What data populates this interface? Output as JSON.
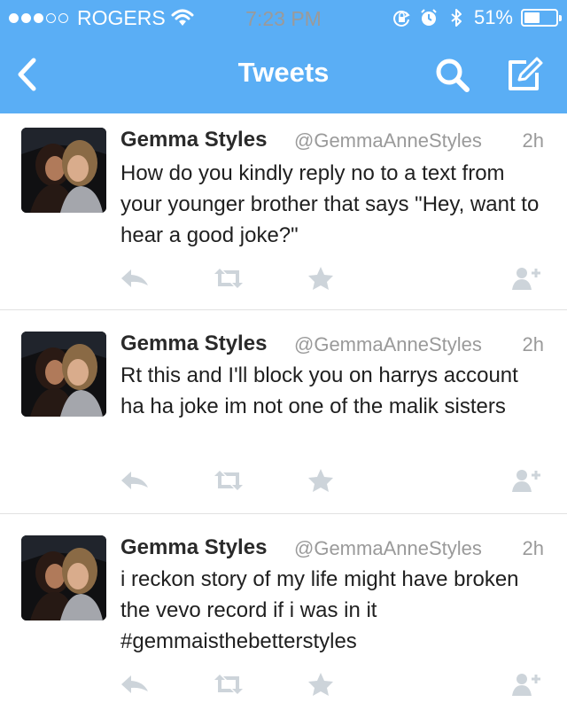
{
  "status_bar": {
    "carrier": "ROGERS",
    "time": "7:23 PM",
    "battery": "51%",
    "battery_level": 0.51
  },
  "nav": {
    "title": "Tweets",
    "back_icon": "chevron-left-icon",
    "search_icon": "search-icon",
    "compose_icon": "compose-icon"
  },
  "tweets": [
    {
      "name": "Gemma Styles",
      "handle": "@GemmaAnneStyles",
      "time": "2h",
      "text": "How do you kindly reply no to a text from your younger brother that says \"Hey, want to hear a good joke?\""
    },
    {
      "name": "Gemma Styles",
      "handle": "@GemmaAnneStyles",
      "time": "2h",
      "text": "Rt this and I'll block you on harrys account ha ha joke im not one of the malik sisters"
    },
    {
      "name": "Gemma Styles",
      "handle": "@GemmaAnneStyles",
      "time": "2h",
      "text": "i reckon story of my life might have broken the vevo record if i was in it #gemmaisthebetterstyles"
    }
  ],
  "colors": {
    "nav_bar": "#5aaef5",
    "action_icon": "#cdd4da"
  }
}
